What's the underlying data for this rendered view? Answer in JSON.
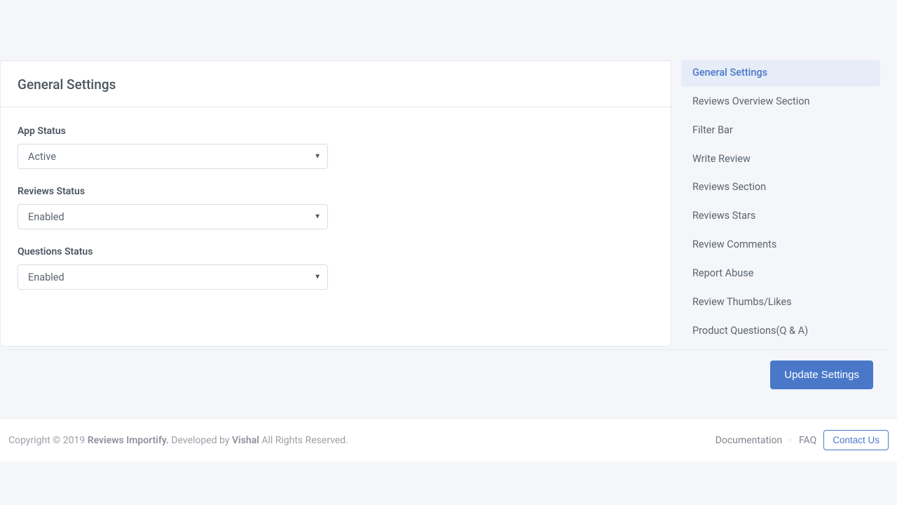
{
  "card": {
    "title": "General Settings",
    "fields": {
      "app_status": {
        "label": "App Status",
        "value": "Active"
      },
      "reviews_status": {
        "label": "Reviews Status",
        "value": "Enabled"
      },
      "questions_status": {
        "label": "Questions Status",
        "value": "Enabled"
      }
    }
  },
  "sidebar": {
    "items": [
      "General Settings",
      "Reviews Overview Section",
      "Filter Bar",
      "Write Review",
      "Reviews Section",
      "Reviews Stars",
      "Review Comments",
      "Report Abuse",
      "Review Thumbs/Likes",
      "Product Questions(Q & A)"
    ],
    "active_index": 0
  },
  "actions": {
    "update": "Update Settings"
  },
  "footer": {
    "copyright_prefix": "Copyright © 2019 ",
    "brand": "Reviews Importify.",
    "dev_prefix": " Developed by ",
    "dev_name": "Vishal",
    "dev_suffix": " All Rights Reserved.",
    "links": {
      "documentation": "Documentation",
      "faq": "FAQ",
      "contact": "Contact Us"
    }
  }
}
